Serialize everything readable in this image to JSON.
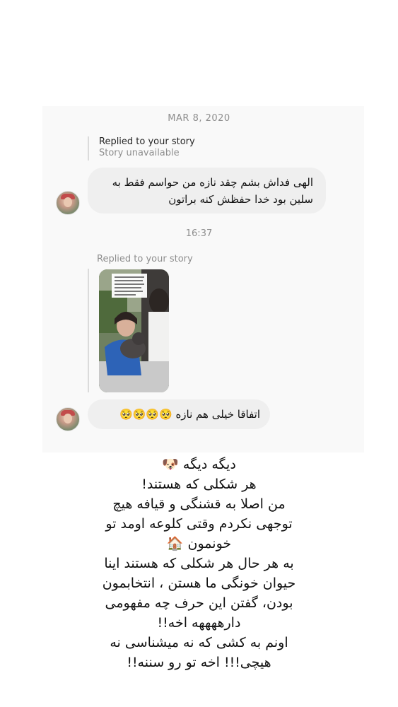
{
  "thread": {
    "date_label": "MAR 8, 2020",
    "time_label": "16:37"
  },
  "reply1": {
    "title": "Replied to your story",
    "subtitle": "Story unavailable"
  },
  "message1": {
    "text": "الهی فداش بشم چقد نازه من حواسم فقط به سلین بود خدا حفظش کنه براتون"
  },
  "reply2": {
    "title": "Replied to your story"
  },
  "message2": {
    "text": "اتفاقا خیلی هم نازه 🥺🥺🥺🥺"
  },
  "caption": {
    "lines": [
      "دیگه دیگه 🐶",
      "هر شکلی که هستند!",
      "من اصلا به قشنگی و قیافه هیچ",
      "توجهی نکردم وقتی کلوعه اومد تو",
      "خونمون 🏠",
      "به هر حال هر شکلی که هستند اینا",
      "حیوان خونگی ما هستن ، انتخابمون",
      "بودن، گفتن این حرف چه مفهومی",
      "دارههههه اخه!!",
      "اونم به کشی که نه میشناسی نه",
      "هیچی!!! اخه تو رو سننه!!"
    ]
  },
  "colors": {
    "bubble": "#efefef",
    "muted_text": "#8e8e8e",
    "card_background": "#f9f9f9"
  }
}
